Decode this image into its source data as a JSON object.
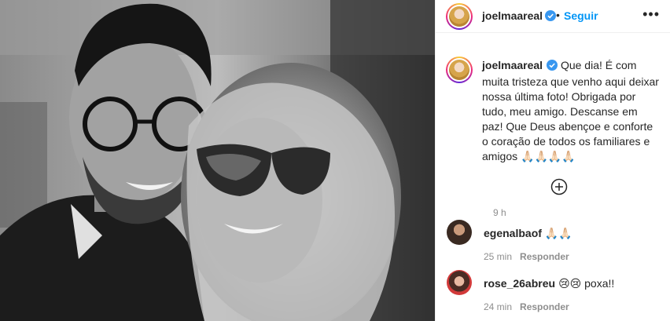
{
  "post": {
    "username": "joelmaareal",
    "dot": "•",
    "follow_label": "Seguir",
    "more_icon": "•••",
    "caption": "Que dia! É com muita tristeza que venho aqui deixar nossa última foto! Obrigada por tudo, meu amigo. Descanse em paz! Que Deus abençoe e conforte o coração de todos os familiares e amigos 🙏🏻🙏🏻🙏🏻🙏🏻",
    "time": "9 h",
    "load_more_icon": "plus-circle-icon"
  },
  "comments": [
    {
      "username": "egenalbaof",
      "text": "🙏🏻🙏🏻",
      "time": "25 min",
      "reply_label": "Responder"
    },
    {
      "username": "rose_26abreu",
      "text": "😢😢 poxa!!",
      "time": "24 min",
      "reply_label": "Responder"
    }
  ],
  "colors": {
    "link_blue": "#0095f6",
    "verified_blue": "#3897f0",
    "meta_gray": "#8e8e8e",
    "text": "#262626",
    "border": "#efefef"
  }
}
